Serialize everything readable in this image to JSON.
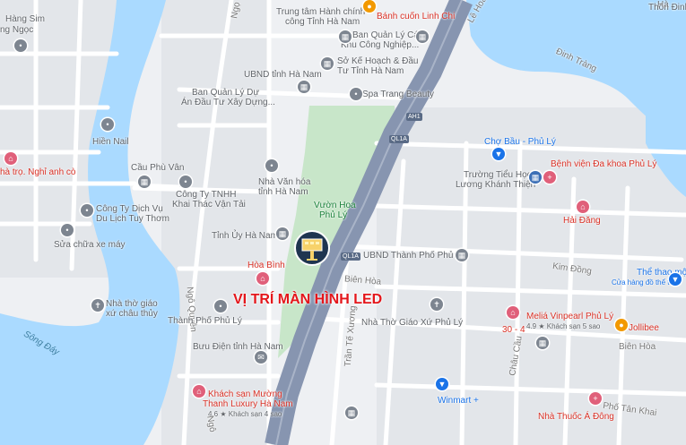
{
  "map": {
    "led_label": "VỊ TRÍ MÀN HÌNH LED",
    "labels": {
      "hang_sim": "Hàng Sim",
      "hung_ngoc": "ng Ngọc",
      "trung_tam_hanh_chinh_1": "Trung tâm Hành chính",
      "trung_tam_hanh_chinh_2": "công Tỉnh Hà Nam",
      "banh_cuon": "Bánh cuốn Linh Chi",
      "le_hoan": "Lê Hoàn",
      "thon_dinh_1": "Hà",
      "thon_dinh_2": "Thôn Đinh",
      "ban_ql_kcn_1": "Ban Quản Lý Các",
      "ban_ql_kcn_2": "Khu Công Nghiệp...",
      "ngoc_road": "Ngọ",
      "so_khdt_1": "Sở Kế Hoạch & Đầu",
      "so_khdt_2": "Tư Tỉnh Hà Nam",
      "dinh_trang": "Đinh Tràng",
      "ubnd_tinh": "UBND tỉnh Hà Nam",
      "ban_ql_da_1": "Ban Quản Lý Dự",
      "ban_ql_da_2": "Án Đầu Tư Xây Dựng...",
      "spa": "Spa Trang Beauty",
      "hien_nail": "Hiền Nail",
      "ah1": "AH1",
      "ql1a_1": "QL1A",
      "cho_bau": "Chợ Bầu - Phủ Lý",
      "benh_vien": "Bệnh viện Đa khoa Phủ Lý",
      "nha_tro": "hà trọ. Nghỉ anh cò",
      "cau_phu_van": "Cầu Phù Vân",
      "nha_van_hoa_1": "Nhà Văn hóa",
      "nha_van_hoa_2": "tỉnh Hà Nam",
      "truong_tieu_hoc_1": "Trường Tiểu Học",
      "truong_tieu_hoc_2": "Lương Khánh Thiện",
      "cong_ty_tnhh_1": "Công Ty TNHH",
      "cong_ty_tnhh_2": "Khai Thác Vận Tải",
      "cong_ty_dv_1": "Công Ty Dịch Vụ",
      "cong_ty_dv_2": "Du Lịch Tuy Thơm",
      "vuon_hoa_1": "Vườn Hoa",
      "vuon_hoa_2": "Phủ Lý",
      "hai_dang": "Hải Đăng",
      "tinh_uy": "Tỉnh Ủy Hà Nam",
      "sua_chua": "Sửa chữa xe máy",
      "ql1a_2": "QL1A",
      "ubnd_thanh_pho": "UBND Thành Phố Phủ Lý",
      "hoa_binh": "Hòa Bình",
      "kim_dong": "Kim Đồng",
      "the_thao_1": "Thể thao mộ",
      "the_thao_2": "Cửa hàng đồ thể thao",
      "bien_hoa_1": "Biên Hòa",
      "nguyen_quyen": "Ngô Quyền",
      "nha_tho_giao_xu_1": "Nhà thờ giáo",
      "nha_tho_giao_xu_2": "xứ châu thủy",
      "melia_1": "Meliá Vinpearl Phủ Lý",
      "melia_2": "4.9 ★ Khách sạn 5 sao",
      "thanh_pho": "Thành Phố Phủ Lý",
      "nha_tho_phu_ly": "Nhà Thờ Giáo Xứ Phủ Lý",
      "tran_te_xuong": "Trần Tế Xương",
      "chau_cau": "Châu Cầu",
      "ba_muoi_bon": "30 - 4",
      "jollibee": "Jollibee",
      "bien_hoa_2": "Biên Hòa",
      "song_day": "Sông Đáy",
      "buu_dien": "Bưu Điện tỉnh Hà Nam",
      "winmart": "Winmart +",
      "ks_muong_1": "Khách sạn Mường",
      "ks_muong_2": "Thanh Luxury Hà Nam",
      "ks_muong_3": "4.6 ★ Khách sạn 4 sao",
      "pho_tan_khai": "Phố Tân Khai",
      "nha_thuoc": "Nhà Thuốc Á Đông",
      "ngo_road": "Ngô"
    },
    "colors": {
      "water": "#aadaff",
      "park": "#c8e6c9",
      "highway": "#8795b0",
      "led_text": "#e4161b"
    }
  }
}
